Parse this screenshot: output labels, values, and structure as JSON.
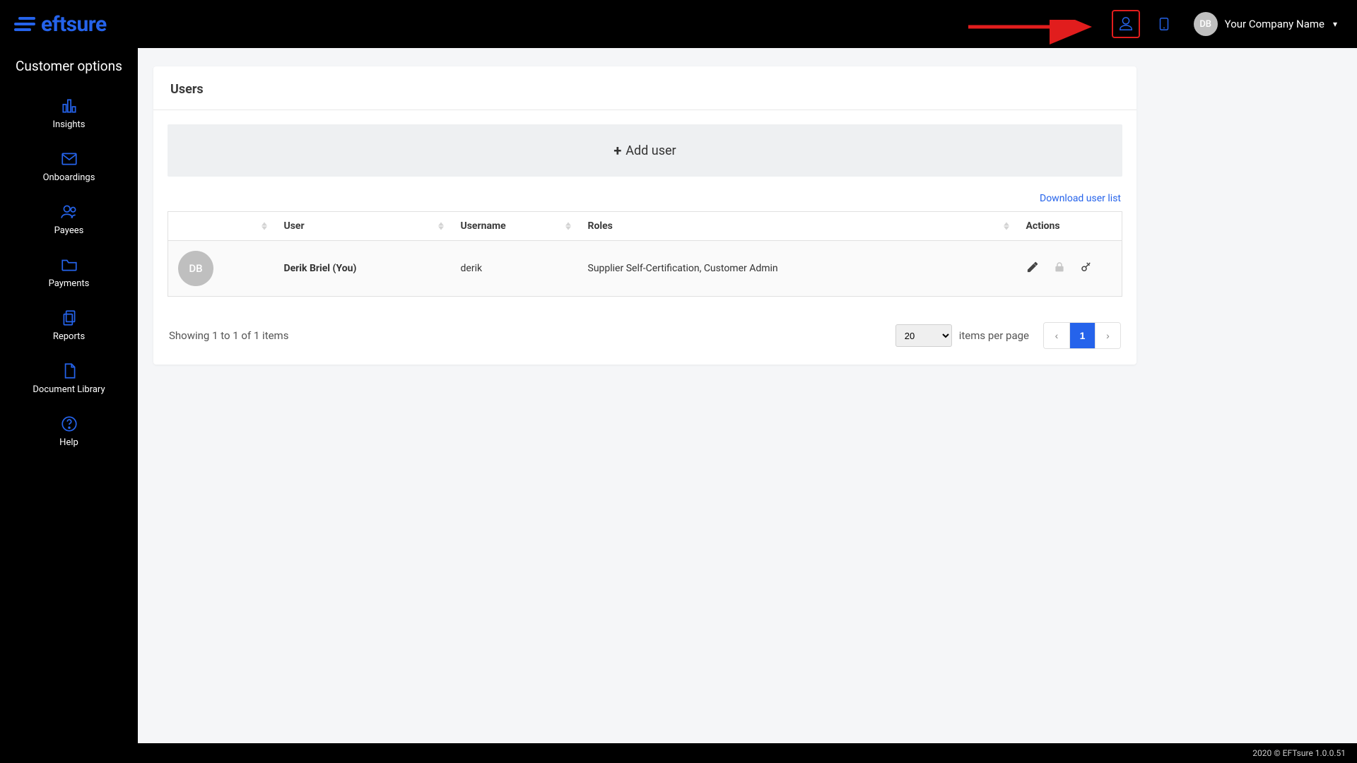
{
  "brand": "eftsure",
  "header": {
    "avatar_initials": "DB",
    "company_name": "Your Company Name"
  },
  "sidebar": {
    "title": "Customer options",
    "items": [
      {
        "label": "Insights"
      },
      {
        "label": "Onboardings"
      },
      {
        "label": "Payees"
      },
      {
        "label": "Payments"
      },
      {
        "label": "Reports"
      },
      {
        "label": "Document Library"
      },
      {
        "label": "Help"
      }
    ]
  },
  "page": {
    "title": "Users",
    "add_user_label": "Add user",
    "download_link": "Download user list"
  },
  "table": {
    "headers": {
      "user": "User",
      "username": "Username",
      "roles": "Roles",
      "actions": "Actions"
    },
    "rows": [
      {
        "avatar": "DB",
        "user": "Derik Briel (You)",
        "username": "derik",
        "roles": "Supplier Self-Certification, Customer Admin"
      }
    ]
  },
  "footer_table": {
    "showing_text": "Showing 1 to 1 of 1 items",
    "page_size": "20",
    "items_per_page_label": "items per page",
    "current_page": "1"
  },
  "footer": "2020 © EFTsure 1.0.0.51"
}
